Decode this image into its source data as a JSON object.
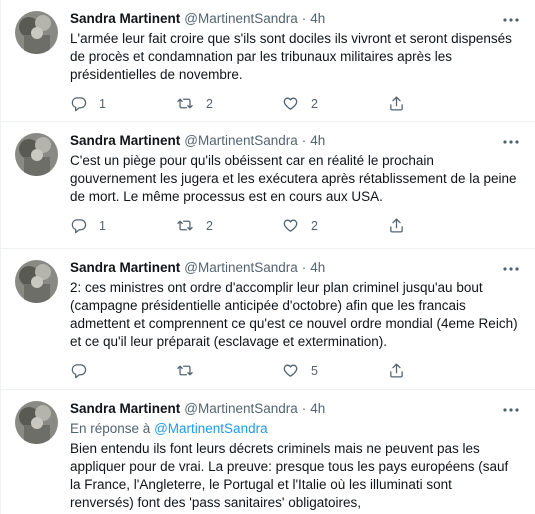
{
  "tweets": [
    {
      "name": "Sandra Martinent",
      "handle": "@MartinentSandra",
      "dot": "·",
      "time": "4h",
      "text": "L'armée leur fait croire que s'ils sont dociles ils vivront et seront dispensés de procès et condamnation par les tribunaux militaires après les présidentielles de novembre.",
      "replies": "1",
      "retweets": "2",
      "likes": "2"
    },
    {
      "name": "Sandra Martinent",
      "handle": "@MartinentSandra",
      "dot": "·",
      "time": "4h",
      "text": "C'est un piège pour qu'ils obéissent car en réalité le prochain gouvernement les jugera et les exécutera après rétablissement de la peine de mort. Le même processus est en cours aux USA.",
      "replies": "1",
      "retweets": "2",
      "likes": "2"
    },
    {
      "name": "Sandra Martinent",
      "handle": "@MartinentSandra",
      "dot": "·",
      "time": "4h",
      "text": "2: ces ministres ont ordre d'accomplir leur plan criminel jusqu'au bout (campagne présidentielle anticipée d'octobre) afin que les francais admettent et comprennent ce qu'est ce nouvel ordre mondial (4eme Reich) et ce qu'il leur préparait (esclavage et extermination).",
      "replies": "",
      "retweets": "",
      "likes": "5"
    },
    {
      "name": "Sandra Martinent",
      "handle": "@MartinentSandra",
      "dot": "·",
      "time": "4h",
      "reply_prefix": "En réponse à",
      "reply_to": "@MartinentSandra",
      "text": "Bien entendu ils font leurs décrets criminels mais ne peuvent pas les appliquer pour de vrai. La preuve: presque tous les pays européens (sauf la France, l'Angleterre, le Portugal et l'Italie où les illuminati sont renversés) font des 'pass sanitaires' obligatoires,"
    }
  ],
  "colors": {
    "text": "#0f1419",
    "secondary": "#536471",
    "link": "#1d9bf0",
    "divider": "#eff3f4"
  },
  "icons": {
    "reply": "reply-icon",
    "retweet": "retweet-icon",
    "like": "heart-icon",
    "share": "share-icon",
    "more": "more-icon"
  }
}
